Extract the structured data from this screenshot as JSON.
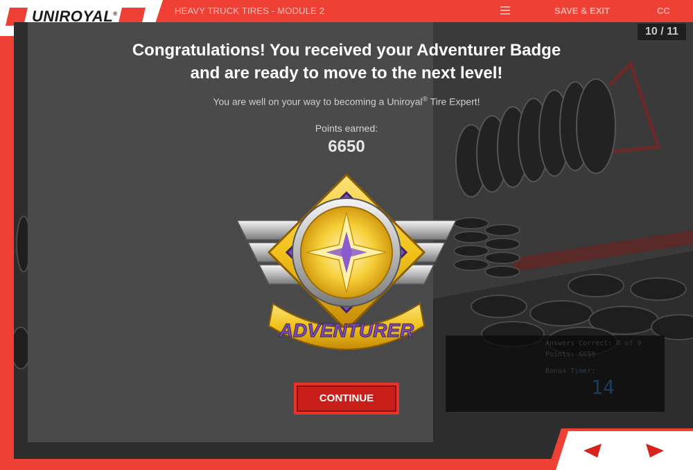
{
  "header": {
    "logo_text": "UNIROYAL",
    "logo_reg": "®",
    "module_title": "HEAVY TRUCK TIRES - MODULE 2",
    "save_exit_label": "SAVE & EXIT",
    "cc_label": "CC",
    "menu_icon": "hamburger-menu-icon"
  },
  "progress": {
    "counter": "10 / 11"
  },
  "modal": {
    "headline_line1": "Congratulations! You received your Adventurer Badge",
    "headline_line2": "and are ready to move to the next level!",
    "subline_pre": "You are well on your way to becoming a Uniroyal",
    "subline_reg": "®",
    "subline_post": " Tire Expert!",
    "points_label": "Points earned:",
    "points_value": "6650",
    "badge_text": "ADVENTURER",
    "continue_label": "CONTINUE"
  },
  "score_overlay": {
    "answers_correct": "Answers Correct: 8 of 9",
    "points": "Points: 6650",
    "bonus_timer_label": "Bonus Timer:",
    "bonus_timer_value": "14"
  },
  "nav": {
    "prev_icon": "previous-arrow-icon",
    "next_icon": "next-arrow-icon"
  },
  "colors": {
    "brand_red": "#ee4035",
    "panel_gray": "#4a4a4a",
    "badge_gold": "#f2c21a",
    "badge_purple": "#7b4fb0"
  }
}
